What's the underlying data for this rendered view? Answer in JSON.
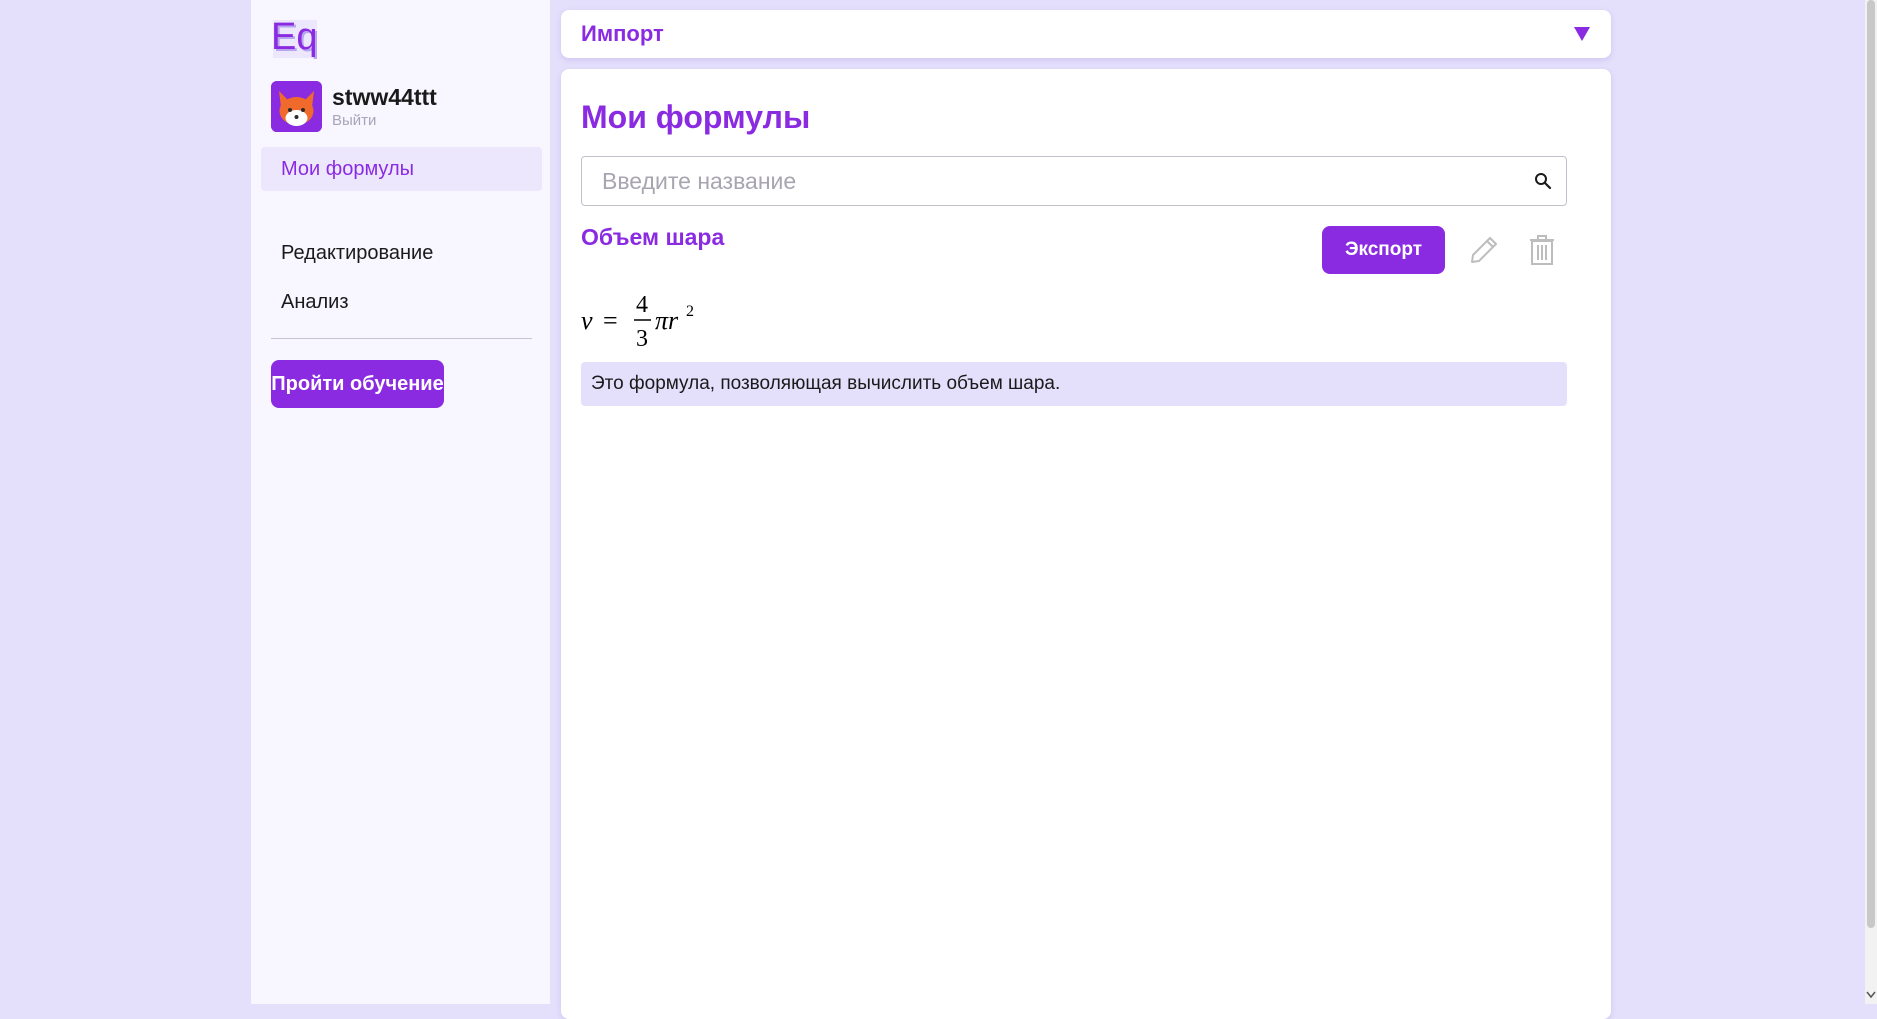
{
  "app": {
    "logo_text": "Eq"
  },
  "user": {
    "name": "stww44ttt",
    "logout_label": "Выйти"
  },
  "sidebar": {
    "items": [
      {
        "label": "Мои формулы",
        "active": true
      },
      {
        "label": "Редактирование",
        "active": false
      },
      {
        "label": "Анализ",
        "active": false
      }
    ],
    "learn_button": "Пройти обучение"
  },
  "import": {
    "label": "Импорт",
    "icon": "triangle-down-icon"
  },
  "main": {
    "title": "Мои формулы",
    "search": {
      "placeholder": "Введите название",
      "value": ""
    },
    "formula": {
      "title": "Объем шара",
      "export_label": "Экспорт",
      "expression": "v = \\frac{4}{3}\\pi r^2",
      "description": "Это формула, позволяющая вычислить объем шара."
    }
  },
  "colors": {
    "accent": "#8a2be2",
    "page_background": "#e4dffb",
    "sidebar_background": "#f8f6ff",
    "description_background": "#e4dffb"
  }
}
